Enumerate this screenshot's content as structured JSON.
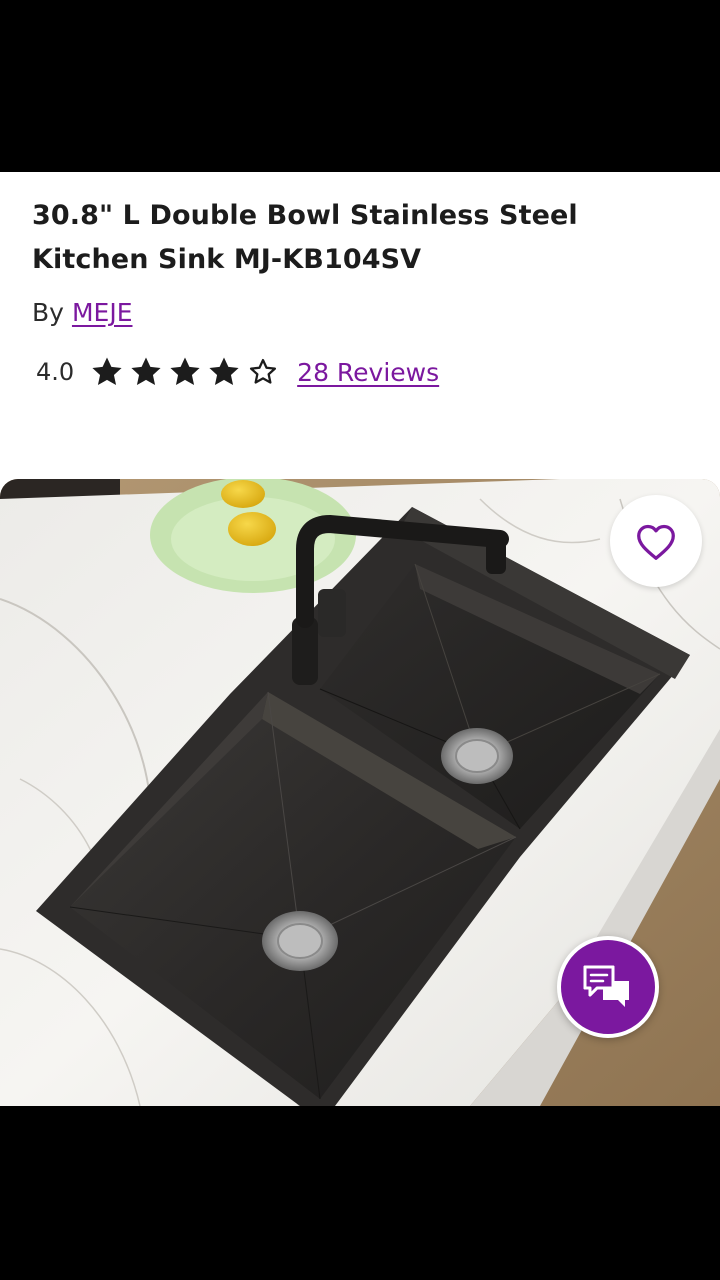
{
  "product": {
    "title": "30.8\" L Double Bowl Stainless Steel Kitchen Sink MJ-KB104SV",
    "by_label": "By",
    "brand": "MEJE",
    "rating": "4.0",
    "rating_value": 4,
    "rating_max": 5,
    "reviews_label": "28 Reviews"
  },
  "colors": {
    "accent": "#7b189f",
    "text": "#1c1c1c",
    "star_fill": "#1c1c1c"
  },
  "icons": {
    "favorite": "heart-outline-icon",
    "chat": "chat-bubbles-icon",
    "star_full": "star-filled-icon",
    "star_empty": "star-outline-icon"
  }
}
